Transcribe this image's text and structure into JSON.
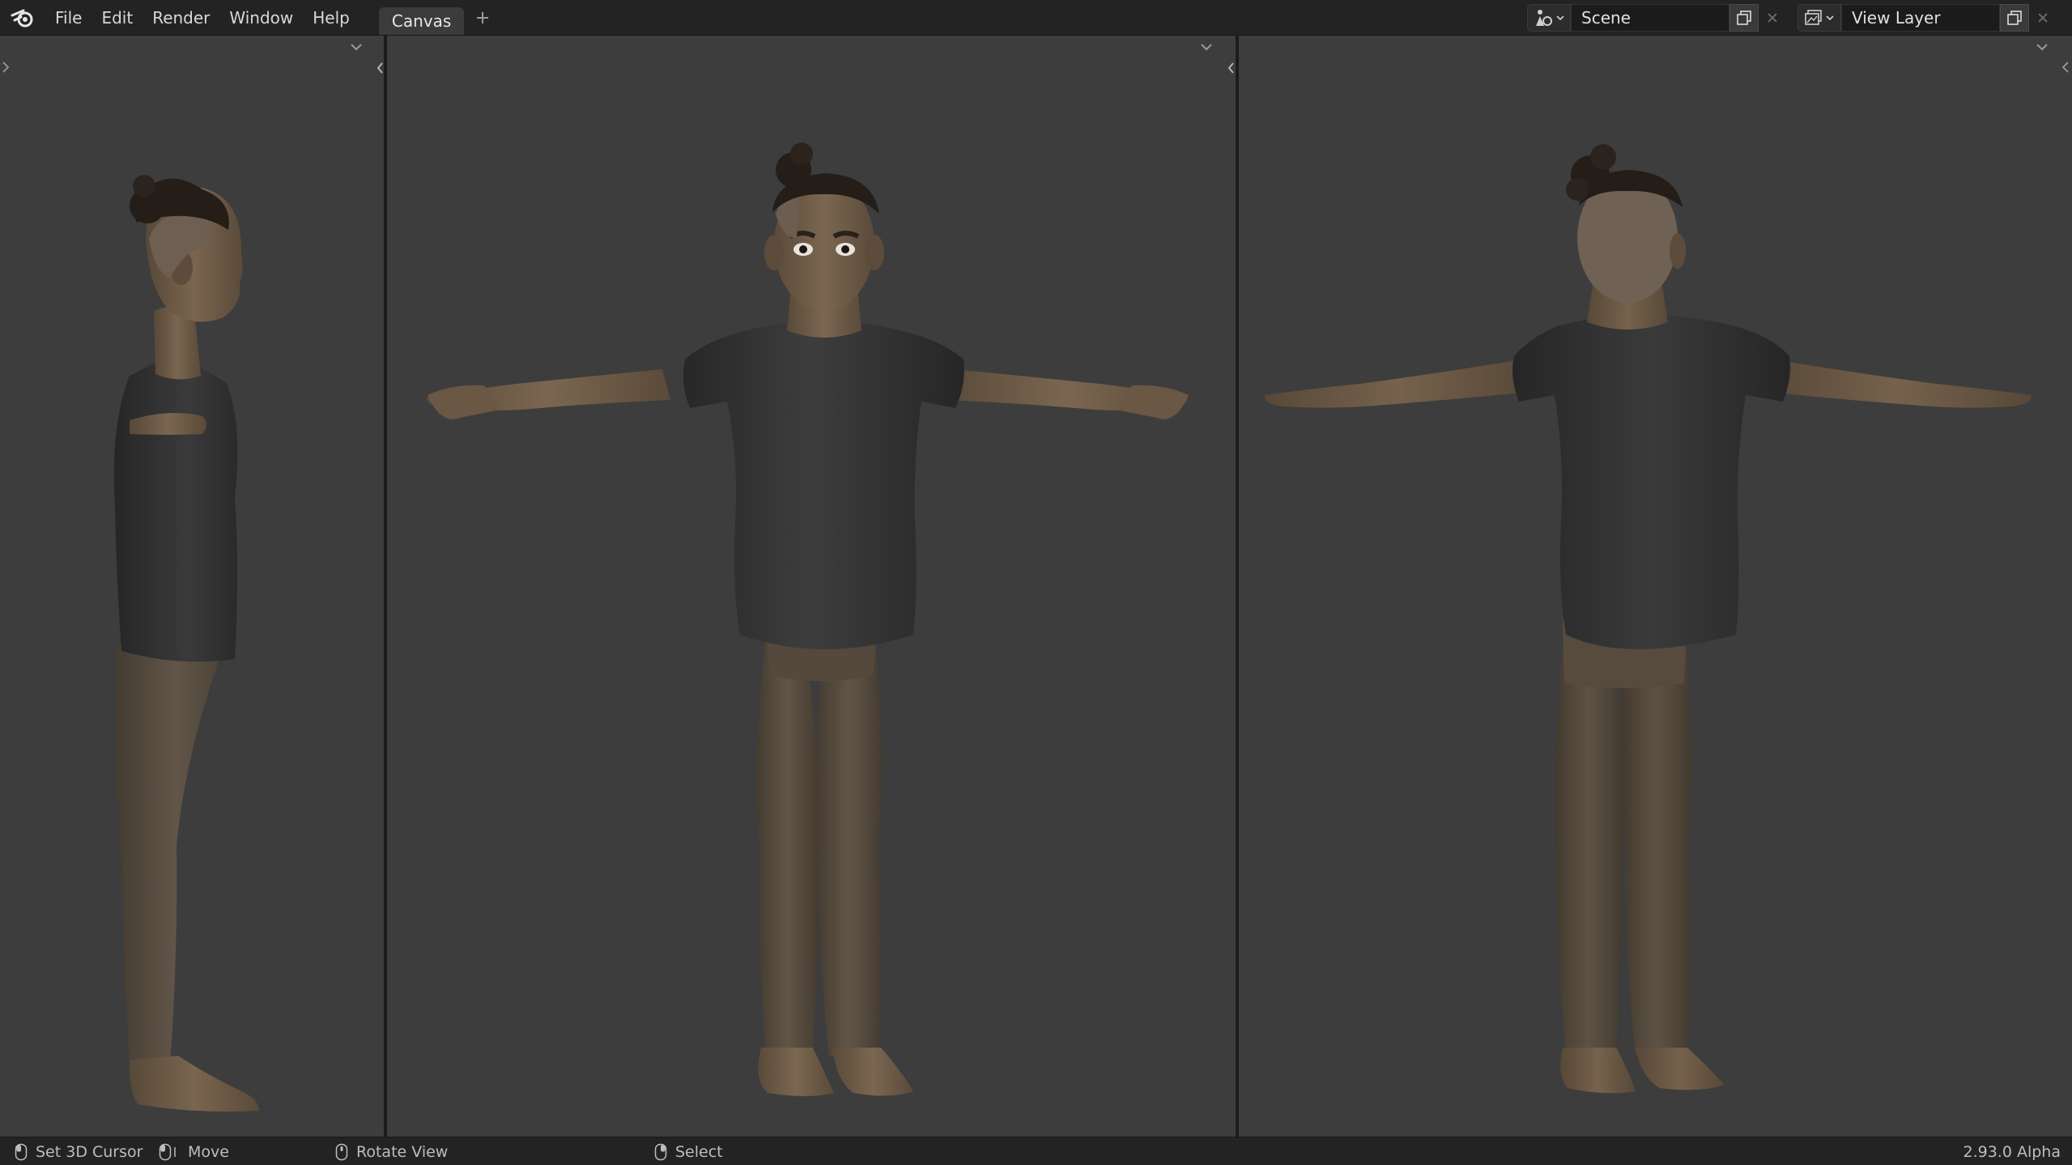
{
  "menu": {
    "items": [
      "File",
      "Edit",
      "Render",
      "Window",
      "Help"
    ]
  },
  "workspace": {
    "active_tab": "Canvas",
    "add_tab_symbol": "+"
  },
  "scene": {
    "name": "Scene",
    "icon": "scene-icon"
  },
  "view_layer": {
    "name": "View Layer",
    "icon": "view-layer-icon"
  },
  "viewports": [
    {
      "view": "side",
      "icon": "chevron-down-icon"
    },
    {
      "view": "front",
      "icon": "chevron-down-icon"
    },
    {
      "view": "back",
      "icon": "chevron-down-icon"
    }
  ],
  "colors": {
    "viewport_bg": "#3d3d3d",
    "skin": "#6b5a46",
    "shirt": "#2f2f30",
    "pants": "#54493c",
    "hair": "#241d18"
  },
  "status": {
    "set_cursor": "Set 3D Cursor",
    "move": "Move",
    "rotate": "Rotate View",
    "select": "Select",
    "version": "2.93.0 Alpha"
  }
}
